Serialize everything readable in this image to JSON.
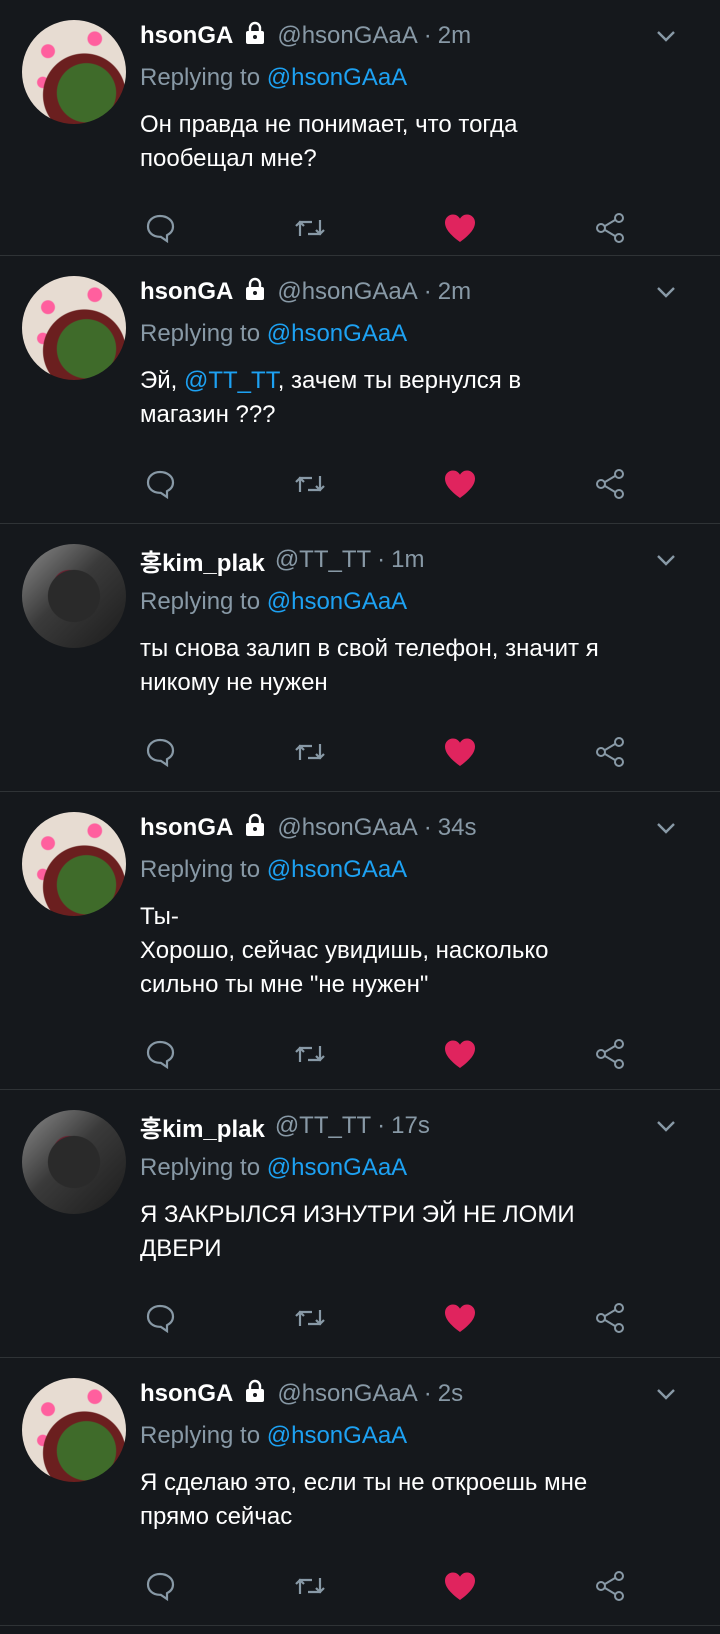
{
  "colors": {
    "background": "#15181c",
    "divider": "#2f3336",
    "secondary_text": "#8899a6",
    "mention": "#1da1f2",
    "like_active": "#e0245e"
  },
  "icons": {
    "reply": "speech-bubble-icon",
    "retweet": "retweet-icon",
    "like": "heart-icon",
    "share": "share-icon",
    "lock": "lock-icon",
    "menu": "chevron-down-icon"
  },
  "tweets": [
    {
      "name": "hsonGA",
      "protected": true,
      "handle": "@hsonGAaA",
      "time": "2m",
      "replying_prefix": "Replying to ",
      "replying_to": "@hsonGAaA",
      "text_parts": [
        "Он правда не понимает, что тогда\nпообещал мне?"
      ],
      "liked": true
    },
    {
      "name": "hsonGA",
      "protected": true,
      "handle": "@hsonGAaA",
      "time": "2m",
      "replying_prefix": "Replying to ",
      "replying_to": "@hsonGAaA",
      "text_parts": [
        "Эй, ",
        "@TT_TT",
        ", зачем ты вернулся в\nмагазин ???"
      ],
      "liked": true
    },
    {
      "name": "홍kim_plak",
      "protected": false,
      "handle": "@TT_TT",
      "time": "1m",
      "replying_prefix": "Replying to ",
      "replying_to": "@hsonGAaA",
      "text_parts": [
        "ты снова залип в свой телефон, значит я\nникому не нужен"
      ],
      "liked": true
    },
    {
      "name": "hsonGA",
      "protected": true,
      "handle": "@hsonGAaA",
      "time": "34s",
      "replying_prefix": "Replying to ",
      "replying_to": "@hsonGAaA",
      "text_parts": [
        "Ты-\nХорошо, сейчас увидишь, насколько\nсильно ты мне \"не нужен\""
      ],
      "liked": true
    },
    {
      "name": "홍kim_plak",
      "protected": false,
      "handle": "@TT_TT",
      "time": "17s",
      "replying_prefix": "Replying to ",
      "replying_to": "@hsonGAaA",
      "text_parts": [
        "Я ЗАКРЫЛСЯ ИЗНУТРИ ЭЙ НЕ ЛОМИ\nДВЕРИ"
      ],
      "liked": true
    },
    {
      "name": "hsonGA",
      "protected": true,
      "handle": "@hsonGAaA",
      "time": "2s",
      "replying_prefix": "Replying to ",
      "replying_to": "@hsonGAaA",
      "text_parts": [
        "Я сделаю это, если ты не откроешь мне\nпрямо сейчас"
      ],
      "liked": true
    }
  ]
}
